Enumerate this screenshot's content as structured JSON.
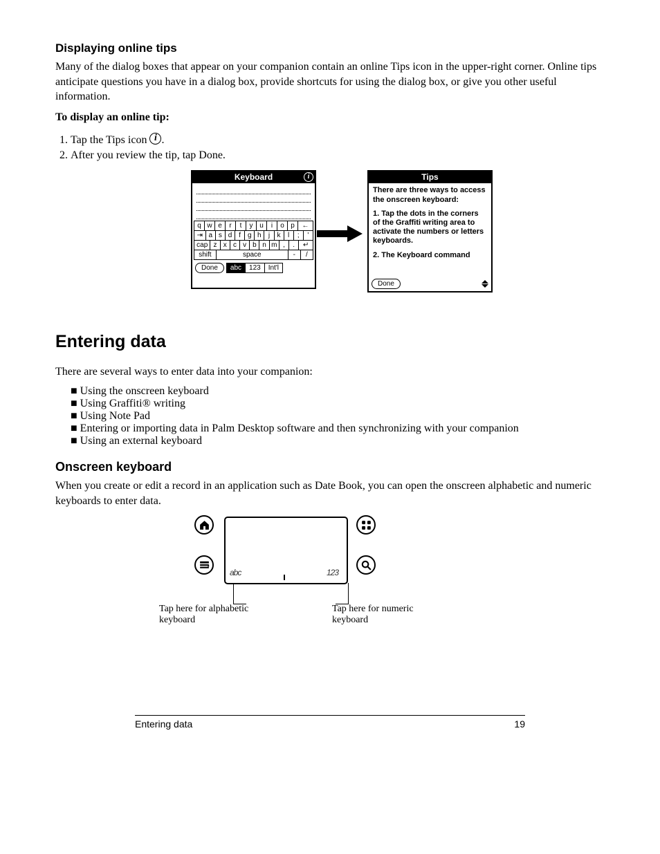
{
  "section1": {
    "heading": "Displaying online tips",
    "p1_a": "Many of the dialog boxes that appear on your companion contain an online Tips icon in the upper-right corner. Online tips anticipate questions you have in a dialog box, provide shortcuts for using the dialog box, or give you other useful information.",
    "step_label": "To display an online tip:",
    "step1_a": "Tap the Tips icon ",
    "step1_b": ".",
    "step2": "After you review the tip, tap Done."
  },
  "keyboard_shot": {
    "title": "Keyboard",
    "row1": [
      "q",
      "w",
      "e",
      "r",
      "t",
      "y",
      "u",
      "i",
      "o",
      "p",
      "←"
    ],
    "row2": [
      "⇥",
      "a",
      "s",
      "d",
      "f",
      "g",
      "h",
      "j",
      "k",
      "l",
      ";",
      "'"
    ],
    "row3": [
      "cap",
      "z",
      "x",
      "c",
      "v",
      "b",
      "n",
      "m",
      ",",
      ".",
      "↵"
    ],
    "row4_shift": "shift",
    "row4_space": "space",
    "row4_dash": "-",
    "row4_slash": "/",
    "done": "Done",
    "seg_abc": "abc",
    "seg_123": "123",
    "seg_intl": "Int'l"
  },
  "tips_shot": {
    "title": "Tips",
    "t1": "There are three ways to access the onscreen keyboard:",
    "t2": "1. Tap the dots in the corners of the Graffiti writing area to activate the numbers or letters keyboards.",
    "t3": "2. The Keyboard command",
    "done": "Done"
  },
  "section2": {
    "h1": "Entering data",
    "p1": "There are several ways to enter data into your companion:",
    "b1": "Using the onscreen keyboard",
    "b2": "Using Graffiti® writing",
    "b3": "Using Note Pad",
    "b4_a": "Entering or importing data in Palm Desktop software and then synchronizing with your companion",
    "b5": "Using an external keyboard",
    "h3": "Onscreen keyboard",
    "p2": "When you create or edit a record in an application such as Date Book, you can open the onscreen alphabetic and numeric keyboards to enter data."
  },
  "silk": {
    "cap_left": "Tap here for alphabetic keyboard",
    "cap_right": "Tap here for numeric keyboard",
    "abc": "abc",
    "num": "123"
  },
  "footer": {
    "left": "Entering data",
    "right": "19"
  }
}
